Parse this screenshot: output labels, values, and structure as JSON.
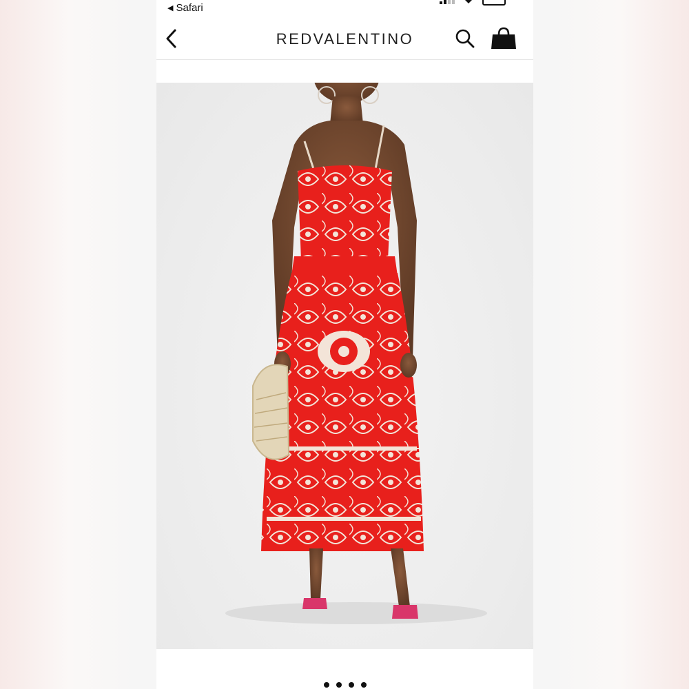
{
  "status_bar": {
    "back_app_label": "Safari"
  },
  "navbar": {
    "brand": "REDVALENTINO",
    "back_icon": "chevron-left-icon",
    "search_icon": "search-icon",
    "bag_icon": "shopping-bag-icon"
  },
  "product": {
    "image_alt": "Model wearing red embroidered midi dress",
    "dress_color": "#e8201c",
    "embroidery_color": "#f3e4d8"
  },
  "carousel": {
    "dot_count": 4
  }
}
